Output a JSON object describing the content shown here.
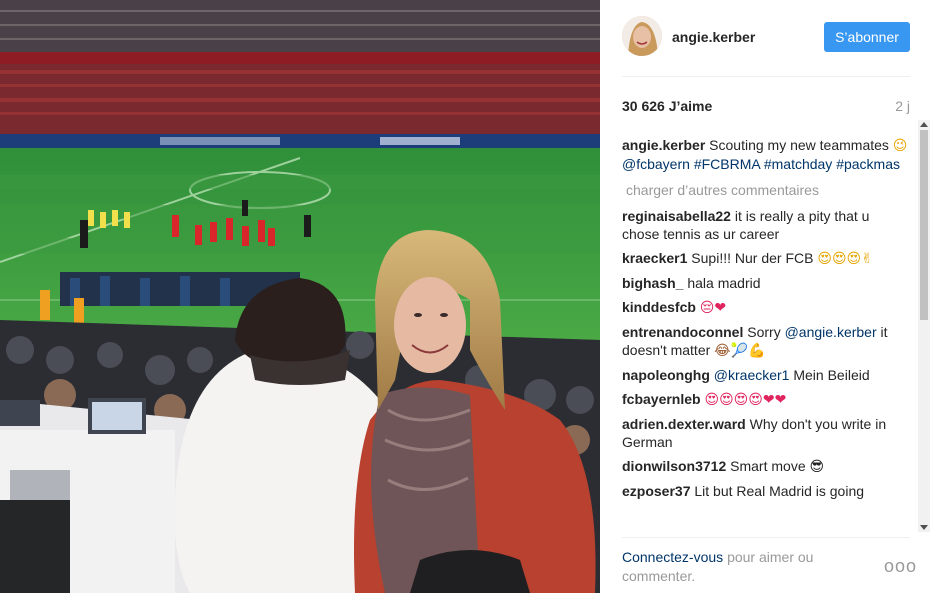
{
  "post": {
    "username": "angie.kerber",
    "follow_label": "S’abonner",
    "likes": "30 626 J’aime",
    "time_ago": "2 j",
    "caption": {
      "user": "angie.kerber",
      "text": "Scouting my new teammates",
      "emoji": "😉",
      "mention": "@fcbayern",
      "tags": [
        "#FCBRMA",
        "#matchday",
        "#packmas"
      ]
    },
    "load_more": "charger d’autres commentaires",
    "comments": [
      {
        "user": "reginaisabella22",
        "text": "it is really a pity that u chose tennis as ur career",
        "emoji": ""
      },
      {
        "user": "kraecker1",
        "text": "Supi!!! Nur der FCB",
        "emoji": "😍😍😍✌"
      },
      {
        "user": "bighash_",
        "text": "hala madrid",
        "emoji": ""
      },
      {
        "user": "kinddesfcb",
        "text": "",
        "emoji": "😔❤"
      },
      {
        "user": "entrenandoconnel",
        "text": "Sorry",
        "mention": "@angie.kerber",
        "text2": "it doesn't matter",
        "emoji": "😂🎾💪"
      },
      {
        "user": "napoleonghg",
        "text": "",
        "mention": "@kraecker1",
        "text2": "Mein Beileid",
        "emoji": ""
      },
      {
        "user": "fcbayernleb",
        "text": "",
        "emoji": "😍😍😍😍❤❤"
      },
      {
        "user": "adrien.dexter.ward",
        "text": "Why don't you write in German",
        "emoji": ""
      },
      {
        "user": "dionwilson3712",
        "text": "Smart move",
        "emoji": "😎"
      },
      {
        "user": "ezposer37",
        "text": "Lit but Real Madrid is going",
        "emoji": ""
      }
    ],
    "footer": {
      "login_link": "Connectez-vous",
      "login_text": "pour aimer ou commenter."
    },
    "more_options": "ooo"
  },
  "icons": {
    "avatar": "profile-picture",
    "more": "ellipsis-icon"
  },
  "colors": {
    "accent": "#3897f0",
    "link": "#003569",
    "muted": "#999999"
  }
}
